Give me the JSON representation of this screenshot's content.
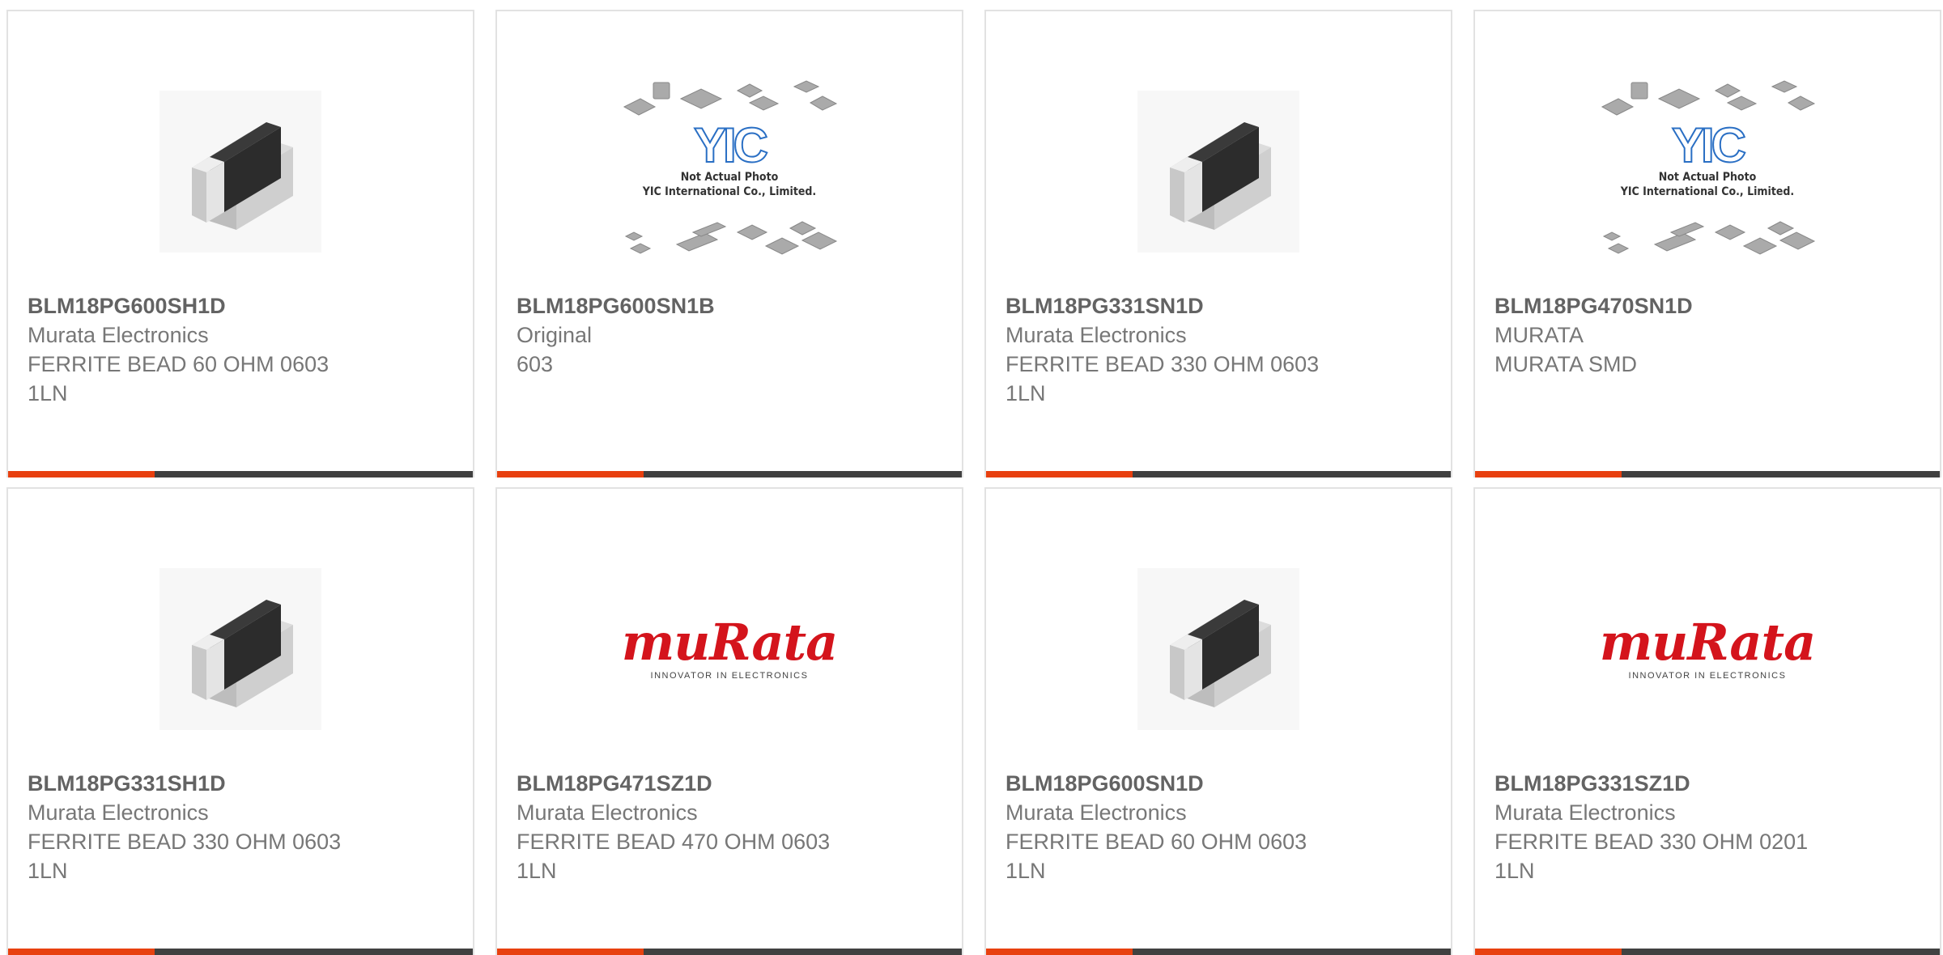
{
  "products": [
    {
      "part": "BLM18PG600SH1D",
      "maker": "Murata Electronics",
      "desc1": "FERRITE BEAD 60 OHM 0603",
      "desc2": "1LN",
      "image": "chip-bead"
    },
    {
      "part": "BLM18PG600SN1B",
      "maker": "Original",
      "desc1": "603",
      "desc2": "",
      "image": "yic-placeholder"
    },
    {
      "part": "BLM18PG331SN1D",
      "maker": "Murata Electronics",
      "desc1": "FERRITE BEAD 330 OHM 0603",
      "desc2": "1LN",
      "image": "chip-bead"
    },
    {
      "part": "BLM18PG470SN1D",
      "maker": "MURATA",
      "desc1": "MURATA SMD",
      "desc2": "",
      "image": "yic-placeholder"
    },
    {
      "part": "BLM18PG331SH1D",
      "maker": "Murata Electronics",
      "desc1": "FERRITE BEAD 330 OHM 0603",
      "desc2": "1LN",
      "image": "chip-bead"
    },
    {
      "part": "BLM18PG471SZ1D",
      "maker": "Murata Electronics",
      "desc1": "FERRITE BEAD 470 OHM 0603",
      "desc2": "1LN",
      "image": "murata-logo"
    },
    {
      "part": "BLM18PG600SN1D",
      "maker": "Murata Electronics",
      "desc1": "FERRITE BEAD 60 OHM 0603",
      "desc2": "1LN",
      "image": "chip-bead"
    },
    {
      "part": "BLM18PG331SZ1D",
      "maker": "Murata Electronics",
      "desc1": "FERRITE BEAD 330 OHM 0201",
      "desc2": "1LN",
      "image": "murata-logo"
    }
  ],
  "yic_image": {
    "brand": "YIC",
    "line1": "Not Actual Photo",
    "line2": "YIC International Co., Limited."
  },
  "murata_logo": {
    "word": "muRata",
    "tagline": "INNOVATOR IN ELECTRONICS"
  },
  "colors": {
    "accent": "#e8400f",
    "bar": "#404040",
    "text": "#777777"
  }
}
